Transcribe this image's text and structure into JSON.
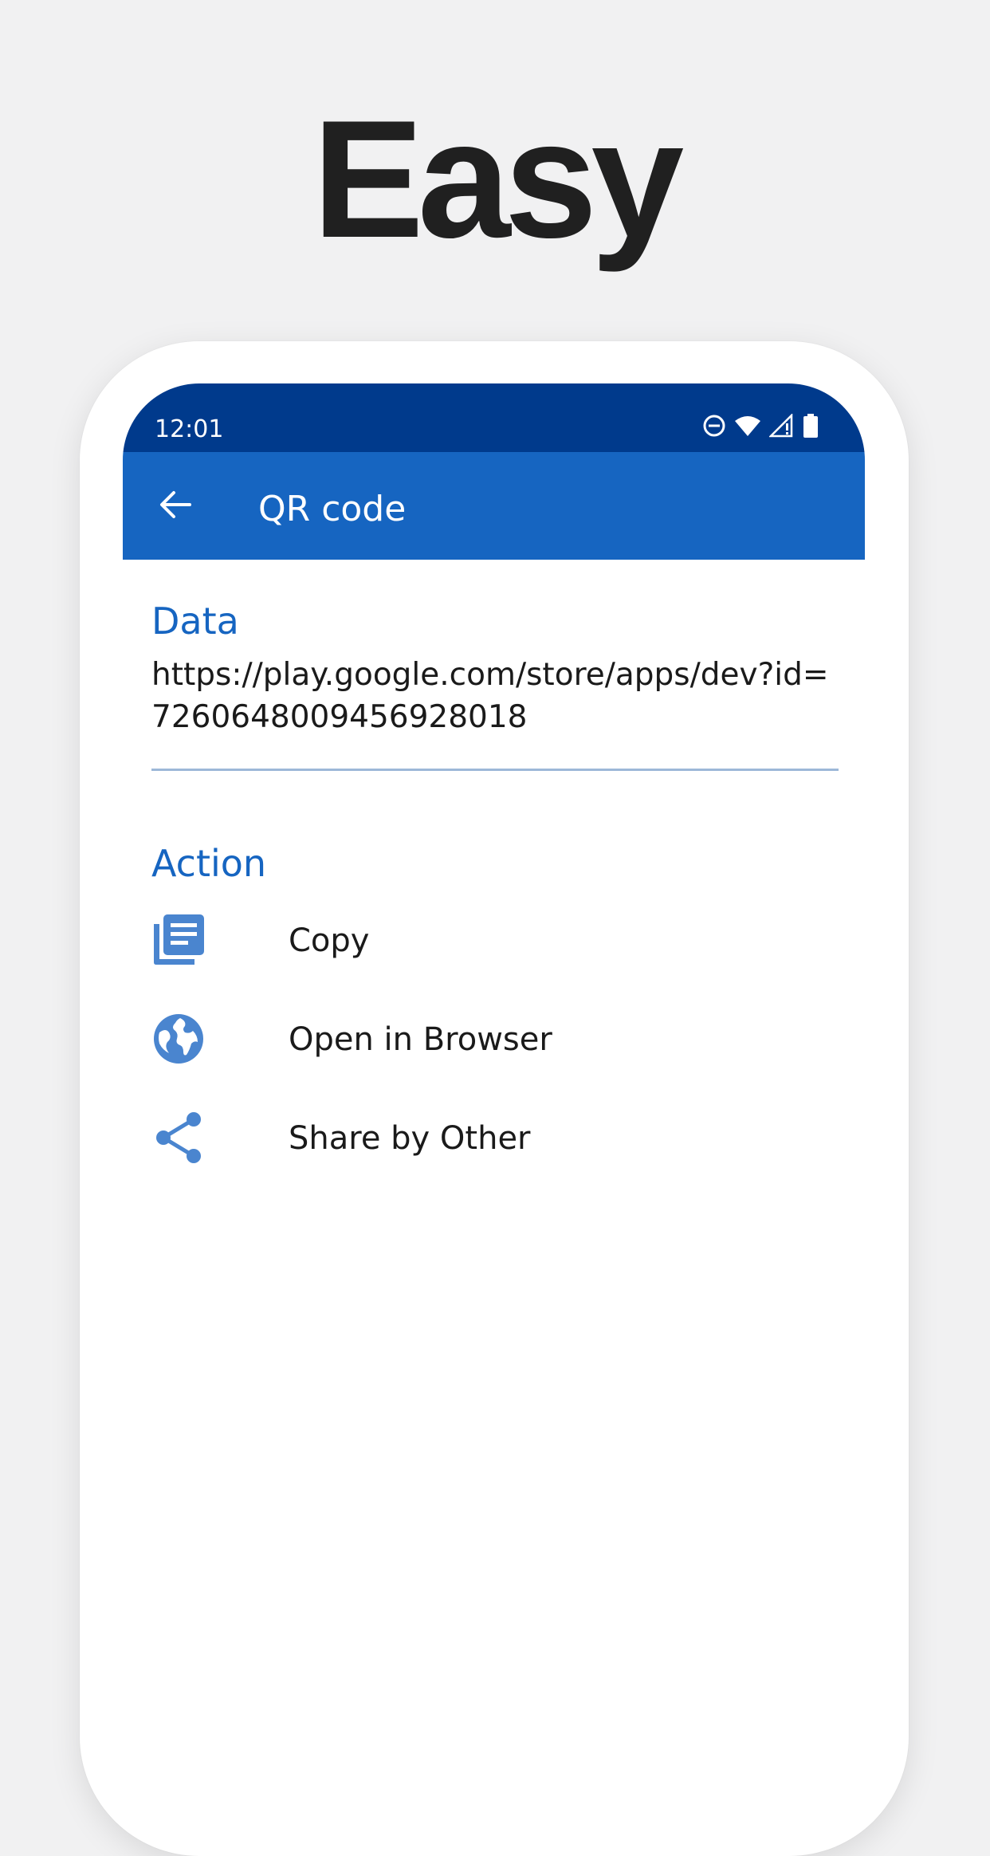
{
  "headline": "Easy",
  "status_bar": {
    "time": "12:01",
    "icons": [
      "do-not-disturb-icon",
      "wifi-icon",
      "signal-icon",
      "battery-icon"
    ]
  },
  "app_bar": {
    "back_icon": "arrow-back-icon",
    "title": "QR code"
  },
  "data_section": {
    "title": "Data",
    "value": "https://play.google.com/store/apps/dev?id=7260648009456928018"
  },
  "action_section": {
    "title": "Action",
    "items": [
      {
        "label": "Copy",
        "icon": "copy-icon"
      },
      {
        "label": "Open in Browser",
        "icon": "globe-icon"
      },
      {
        "label": "Share by Other",
        "icon": "share-icon"
      }
    ]
  },
  "colors": {
    "status_bar": "#003a8c",
    "app_bar": "#1665c1",
    "accent": "#1665c1",
    "icon": "#4a85cf",
    "background": "#f1f1f2"
  }
}
